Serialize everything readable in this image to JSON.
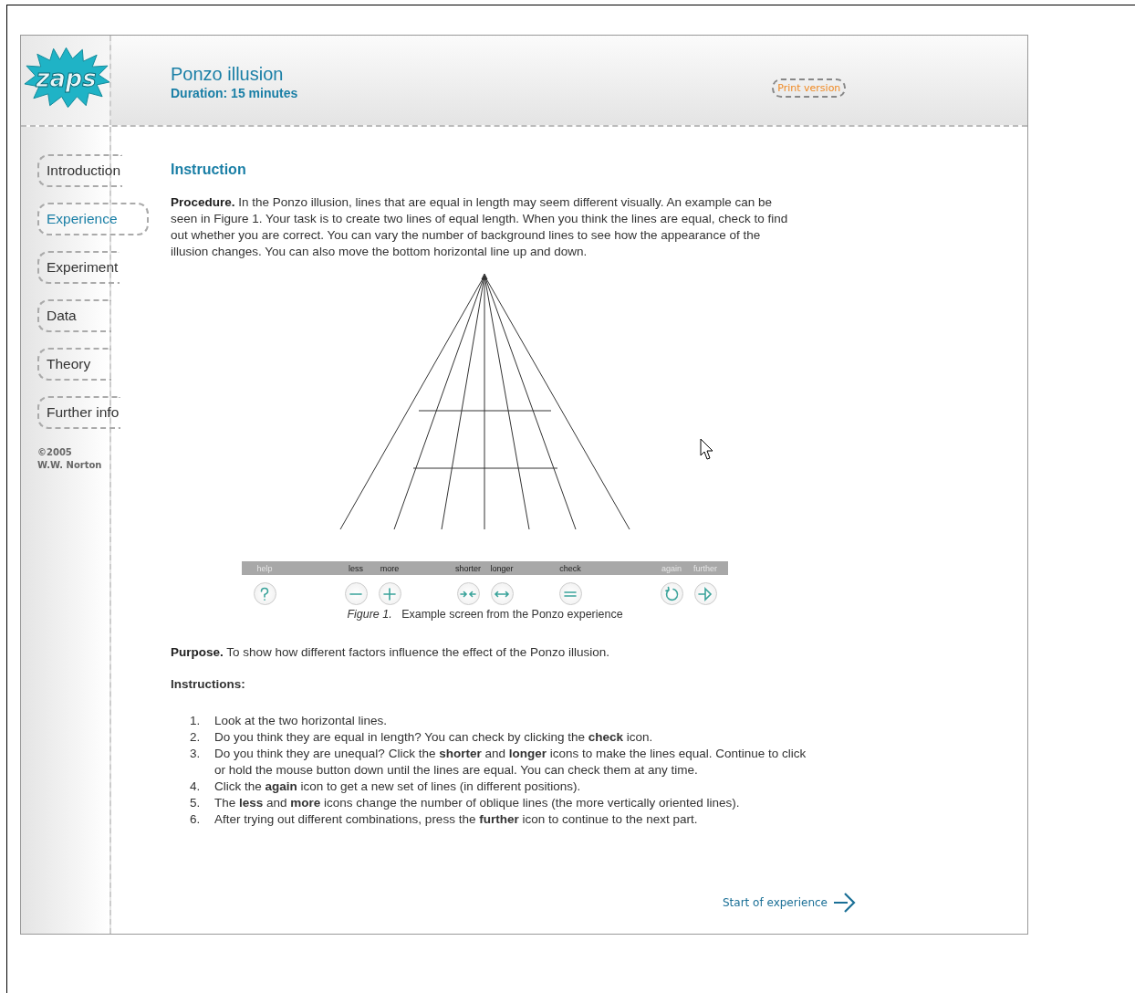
{
  "header": {
    "logo": "zaps",
    "title": "Ponzo illusion",
    "duration": "Duration: 15 minutes",
    "print_button": "Print version"
  },
  "nav": [
    {
      "label": "Introduction",
      "selected": false
    },
    {
      "label": "Experience",
      "selected": true
    },
    {
      "label": "Experiment",
      "selected": false
    },
    {
      "label": "Data",
      "selected": false
    },
    {
      "label": "Theory",
      "selected": false
    },
    {
      "label": "Further info",
      "selected": false
    }
  ],
  "copyright": [
    "©2005",
    "W.W. Norton"
  ],
  "content": {
    "heading": "Instruction",
    "procedure": "**Procedure.** In the Ponzo illusion, lines that are equal in length may seem different visually. An example can be seen in Figure 1. Your task is to create two lines of equal length. When you think the lines are equal, check to find out whether you are correct. You can vary the number of background lines to see how the appearance of the illusion changes. You can also move the bottom horizontal line up and down.",
    "figure": {
      "controls": [
        {
          "kind": "help",
          "label": "help",
          "disabled": true
        },
        {
          "kind": "less",
          "label": "less",
          "disabled": false
        },
        {
          "kind": "more",
          "label": "more",
          "disabled": false
        },
        {
          "kind": "shorter",
          "label": "shorter",
          "disabled": false
        },
        {
          "kind": "longer",
          "label": "longer",
          "disabled": false
        },
        {
          "kind": "check",
          "label": "check",
          "disabled": false
        },
        {
          "kind": "again",
          "label": "again",
          "disabled": true
        },
        {
          "kind": "further",
          "label": "further",
          "disabled": true
        }
      ],
      "caption_label": "Figure 1.",
      "caption": "Example screen from the Ponzo experience"
    },
    "purpose": "**Purpose.** To show how different factors influence the effect of the Ponzo illusion.",
    "instructions_heading": "Instructions:",
    "instructions": [
      {
        "number": "1.",
        "text": "Look at the two horizontal lines."
      },
      {
        "number": "2.",
        "text": "Do you think they are equal in length? You can check by clicking the **check** icon."
      },
      {
        "number": "3.",
        "text": "Do you think they are unequal? Click the **shorter** and **longer** icons to make the lines equal. Continue to click or hold the mouse button down until the lines are equal. You can check them at any time."
      },
      {
        "number": "4.",
        "text": "Click the **again** icon to get a new set of lines (in different positions)."
      },
      {
        "number": "5.",
        "text": "The **less** and **more** icons change the number of oblique lines (the more vertically oriented lines)."
      },
      {
        "number": "6.",
        "text": "After trying out different combinations, press the **further** icon to continue to the next part."
      }
    ],
    "next_link": "Start of experience"
  }
}
